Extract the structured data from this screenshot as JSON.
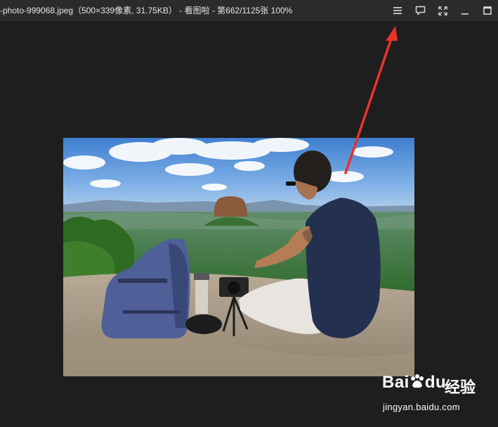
{
  "window": {
    "title": "-photo-999068.jpeg（500×339像素, 31.75KB） - 看图啦 - 第662/1125张 100%",
    "controls": [
      "menu-icon",
      "comment-icon",
      "fullscreen-icon",
      "minimize-icon",
      "maximize-icon"
    ]
  },
  "colors": {
    "titlebar": "#2b2b2b",
    "viewer_bg": "#1e1e1e",
    "annotation_arrow": "#e8322c"
  },
  "photo": {
    "alt": "Man sitting on a rock summit next to a backpack and camera, looking at a distant rock formation over forest"
  },
  "watermark": {
    "logo_text": "Bai",
    "logo_text2": "du",
    "cn_text": "经验",
    "url": "jingyan.baidu.com"
  }
}
